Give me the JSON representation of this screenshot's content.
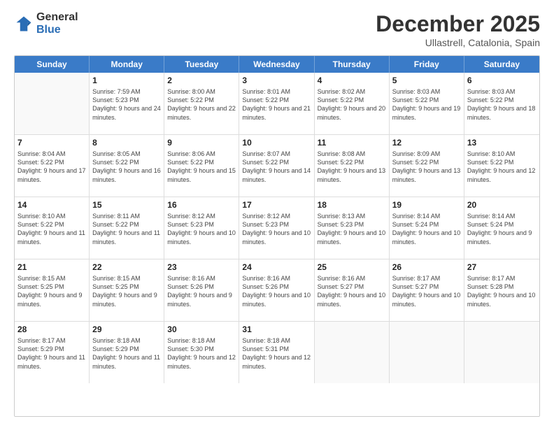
{
  "logo": {
    "general": "General",
    "blue": "Blue"
  },
  "header": {
    "month": "December 2025",
    "location": "Ullastrell, Catalonia, Spain"
  },
  "days_of_week": [
    "Sunday",
    "Monday",
    "Tuesday",
    "Wednesday",
    "Thursday",
    "Friday",
    "Saturday"
  ],
  "weeks": [
    [
      {
        "day": null
      },
      {
        "day": "1",
        "sunrise": "Sunrise: 7:59 AM",
        "sunset": "Sunset: 5:23 PM",
        "daylight": "Daylight: 9 hours and 24 minutes."
      },
      {
        "day": "2",
        "sunrise": "Sunrise: 8:00 AM",
        "sunset": "Sunset: 5:22 PM",
        "daylight": "Daylight: 9 hours and 22 minutes."
      },
      {
        "day": "3",
        "sunrise": "Sunrise: 8:01 AM",
        "sunset": "Sunset: 5:22 PM",
        "daylight": "Daylight: 9 hours and 21 minutes."
      },
      {
        "day": "4",
        "sunrise": "Sunrise: 8:02 AM",
        "sunset": "Sunset: 5:22 PM",
        "daylight": "Daylight: 9 hours and 20 minutes."
      },
      {
        "day": "5",
        "sunrise": "Sunrise: 8:03 AM",
        "sunset": "Sunset: 5:22 PM",
        "daylight": "Daylight: 9 hours and 19 minutes."
      },
      {
        "day": "6",
        "sunrise": "Sunrise: 8:03 AM",
        "sunset": "Sunset: 5:22 PM",
        "daylight": "Daylight: 9 hours and 18 minutes."
      }
    ],
    [
      {
        "day": "7",
        "sunrise": "Sunrise: 8:04 AM",
        "sunset": "Sunset: 5:22 PM",
        "daylight": "Daylight: 9 hours and 17 minutes."
      },
      {
        "day": "8",
        "sunrise": "Sunrise: 8:05 AM",
        "sunset": "Sunset: 5:22 PM",
        "daylight": "Daylight: 9 hours and 16 minutes."
      },
      {
        "day": "9",
        "sunrise": "Sunrise: 8:06 AM",
        "sunset": "Sunset: 5:22 PM",
        "daylight": "Daylight: 9 hours and 15 minutes."
      },
      {
        "day": "10",
        "sunrise": "Sunrise: 8:07 AM",
        "sunset": "Sunset: 5:22 PM",
        "daylight": "Daylight: 9 hours and 14 minutes."
      },
      {
        "day": "11",
        "sunrise": "Sunrise: 8:08 AM",
        "sunset": "Sunset: 5:22 PM",
        "daylight": "Daylight: 9 hours and 13 minutes."
      },
      {
        "day": "12",
        "sunrise": "Sunrise: 8:09 AM",
        "sunset": "Sunset: 5:22 PM",
        "daylight": "Daylight: 9 hours and 13 minutes."
      },
      {
        "day": "13",
        "sunrise": "Sunrise: 8:10 AM",
        "sunset": "Sunset: 5:22 PM",
        "daylight": "Daylight: 9 hours and 12 minutes."
      }
    ],
    [
      {
        "day": "14",
        "sunrise": "Sunrise: 8:10 AM",
        "sunset": "Sunset: 5:22 PM",
        "daylight": "Daylight: 9 hours and 11 minutes."
      },
      {
        "day": "15",
        "sunrise": "Sunrise: 8:11 AM",
        "sunset": "Sunset: 5:22 PM",
        "daylight": "Daylight: 9 hours and 11 minutes."
      },
      {
        "day": "16",
        "sunrise": "Sunrise: 8:12 AM",
        "sunset": "Sunset: 5:23 PM",
        "daylight": "Daylight: 9 hours and 10 minutes."
      },
      {
        "day": "17",
        "sunrise": "Sunrise: 8:12 AM",
        "sunset": "Sunset: 5:23 PM",
        "daylight": "Daylight: 9 hours and 10 minutes."
      },
      {
        "day": "18",
        "sunrise": "Sunrise: 8:13 AM",
        "sunset": "Sunset: 5:23 PM",
        "daylight": "Daylight: 9 hours and 10 minutes."
      },
      {
        "day": "19",
        "sunrise": "Sunrise: 8:14 AM",
        "sunset": "Sunset: 5:24 PM",
        "daylight": "Daylight: 9 hours and 10 minutes."
      },
      {
        "day": "20",
        "sunrise": "Sunrise: 8:14 AM",
        "sunset": "Sunset: 5:24 PM",
        "daylight": "Daylight: 9 hours and 9 minutes."
      }
    ],
    [
      {
        "day": "21",
        "sunrise": "Sunrise: 8:15 AM",
        "sunset": "Sunset: 5:25 PM",
        "daylight": "Daylight: 9 hours and 9 minutes."
      },
      {
        "day": "22",
        "sunrise": "Sunrise: 8:15 AM",
        "sunset": "Sunset: 5:25 PM",
        "daylight": "Daylight: 9 hours and 9 minutes."
      },
      {
        "day": "23",
        "sunrise": "Sunrise: 8:16 AM",
        "sunset": "Sunset: 5:26 PM",
        "daylight": "Daylight: 9 hours and 9 minutes."
      },
      {
        "day": "24",
        "sunrise": "Sunrise: 8:16 AM",
        "sunset": "Sunset: 5:26 PM",
        "daylight": "Daylight: 9 hours and 10 minutes."
      },
      {
        "day": "25",
        "sunrise": "Sunrise: 8:16 AM",
        "sunset": "Sunset: 5:27 PM",
        "daylight": "Daylight: 9 hours and 10 minutes."
      },
      {
        "day": "26",
        "sunrise": "Sunrise: 8:17 AM",
        "sunset": "Sunset: 5:27 PM",
        "daylight": "Daylight: 9 hours and 10 minutes."
      },
      {
        "day": "27",
        "sunrise": "Sunrise: 8:17 AM",
        "sunset": "Sunset: 5:28 PM",
        "daylight": "Daylight: 9 hours and 10 minutes."
      }
    ],
    [
      {
        "day": "28",
        "sunrise": "Sunrise: 8:17 AM",
        "sunset": "Sunset: 5:29 PM",
        "daylight": "Daylight: 9 hours and 11 minutes."
      },
      {
        "day": "29",
        "sunrise": "Sunrise: 8:18 AM",
        "sunset": "Sunset: 5:29 PM",
        "daylight": "Daylight: 9 hours and 11 minutes."
      },
      {
        "day": "30",
        "sunrise": "Sunrise: 8:18 AM",
        "sunset": "Sunset: 5:30 PM",
        "daylight": "Daylight: 9 hours and 12 minutes."
      },
      {
        "day": "31",
        "sunrise": "Sunrise: 8:18 AM",
        "sunset": "Sunset: 5:31 PM",
        "daylight": "Daylight: 9 hours and 12 minutes."
      },
      {
        "day": null
      },
      {
        "day": null
      },
      {
        "day": null
      }
    ]
  ]
}
